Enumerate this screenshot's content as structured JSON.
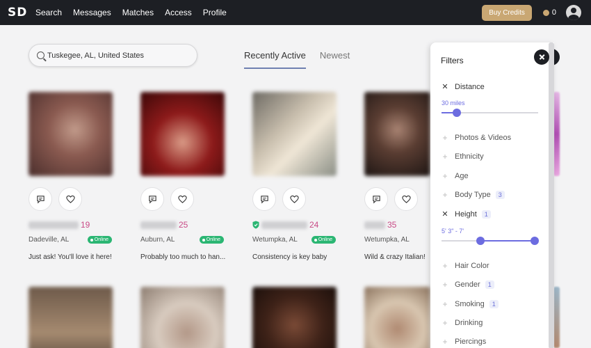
{
  "nav": {
    "logo": "SD",
    "links": [
      "Search",
      "Messages",
      "Matches",
      "Access",
      "Profile"
    ],
    "buy_credits": "Buy Credits",
    "credits_count": "0"
  },
  "search": {
    "value": "Tuskegee, AL, United States"
  },
  "tabs": [
    {
      "label": "Recently Active",
      "active": true
    },
    {
      "label": "Newest",
      "active": false
    }
  ],
  "profiles": [
    {
      "age": "19",
      "location": "Dadeville, AL",
      "online": "Online",
      "bio": "Just ask! You'll love it here!",
      "verified": false
    },
    {
      "age": "25",
      "location": "Auburn, AL",
      "online": "Online",
      "bio": "Probably too much to han...",
      "verified": false
    },
    {
      "age": "24",
      "location": "Wetumpka, AL",
      "online": "Online",
      "bio": "Consistency is key baby",
      "verified": true
    },
    {
      "age": "35",
      "location": "Wetumpka, AL",
      "online": "",
      "bio": "Wild & crazy Italian!",
      "verified": false
    }
  ],
  "filters": {
    "title": "Filters",
    "distance": {
      "label": "Distance",
      "value": "30 miles",
      "fraction": 0.16
    },
    "items": [
      {
        "label": "Photos & Videos",
        "count": ""
      },
      {
        "label": "Ethnicity",
        "count": ""
      },
      {
        "label": "Age",
        "count": ""
      },
      {
        "label": "Body Type",
        "count": "3"
      }
    ],
    "height": {
      "label": "Height",
      "count": "1",
      "range": "5' 3\" - 7'",
      "low_fraction": 0.42,
      "high_fraction": 1.0
    },
    "items2": [
      {
        "label": "Hair Color",
        "count": ""
      },
      {
        "label": "Gender",
        "count": "1"
      },
      {
        "label": "Smoking",
        "count": "1"
      },
      {
        "label": "Drinking",
        "count": ""
      },
      {
        "label": "Piercings",
        "count": ""
      }
    ]
  },
  "colors": {
    "nav_bg": "#1d1f24",
    "accent_gold": "#c9a773",
    "age_pink": "#c84a86",
    "online_green": "#2bb673",
    "slider_purple": "#6c6ce0"
  }
}
